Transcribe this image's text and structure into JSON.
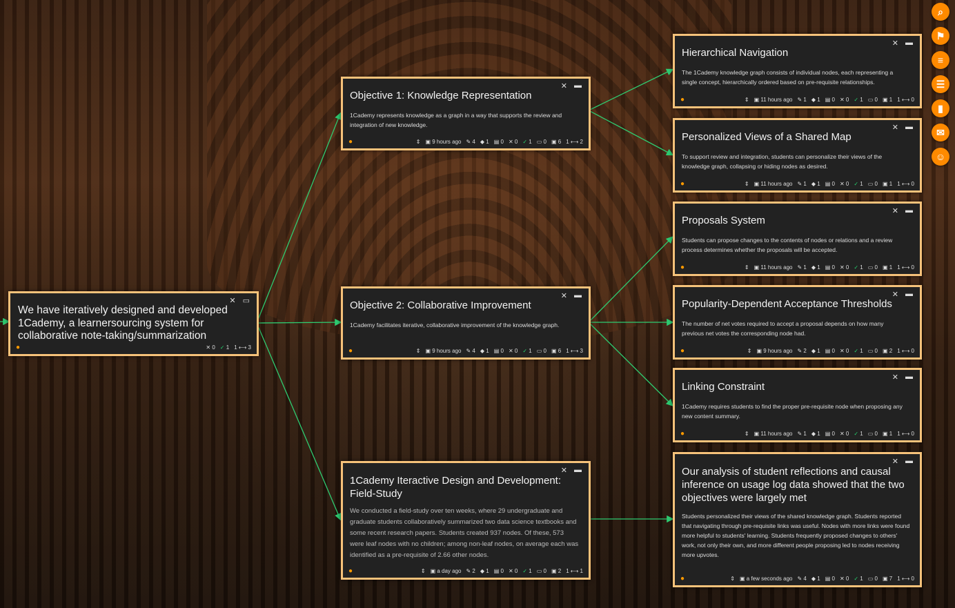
{
  "sidebar": {
    "buttons": [
      {
        "icon": "search-icon",
        "glyph": "⌕"
      },
      {
        "icon": "bookmark-icon",
        "glyph": "⚑"
      },
      {
        "icon": "pending-proposals-icon",
        "glyph": "≡"
      },
      {
        "icon": "list-icon",
        "glyph": "☰"
      },
      {
        "icon": "leaderboard-icon",
        "glyph": "▮"
      },
      {
        "icon": "chat-icon",
        "glyph": "✉"
      },
      {
        "icon": "users-icon",
        "glyph": "☺"
      }
    ]
  },
  "nodes": [
    {
      "id": "root",
      "title": "We have iteratively designed and developed 1Cademy, a learnersourcing system for collaborative note-taking/summarization",
      "content": "",
      "footer": {
        "time": "",
        "edits": "",
        "tags": "",
        "comments": "",
        "wrong": "0",
        "correct": "1",
        "bookmarks": "",
        "proposals": "",
        "links": "1 ⟷ 3"
      }
    },
    {
      "id": "obj1",
      "title": "Objective 1: Knowledge Representation",
      "content": "1Cademy represents knowledge as a graph in a way that supports the review and integration of new knowledge.",
      "footer": {
        "time": "9 hours ago",
        "edits": "4",
        "tags": "1",
        "comments": "0",
        "wrong": "0",
        "correct": "1",
        "bookmarks": "0",
        "proposals": "6",
        "links": "1 ⟷ 2"
      }
    },
    {
      "id": "obj2",
      "title": "Objective 2: Collaborative Improvement",
      "content": "1Cademy facilitates iterative, collaborative improvement of the knowledge graph.",
      "footer": {
        "time": "9 hours ago",
        "edits": "4",
        "tags": "1",
        "comments": "0",
        "wrong": "0",
        "correct": "1",
        "bookmarks": "0",
        "proposals": "6",
        "links": "1 ⟷ 3"
      }
    },
    {
      "id": "field",
      "title": "1Cademy Iteractive Design and Development: Field-Study",
      "content": "We conducted a field-study over ten weeks, where 29 undergraduate and graduate students collaboratively summarized two data science textbooks and some recent research papers. Students created 937 nodes. Of these, 573 were leaf nodes with no children; among non-leaf nodes, on average each was identified as a pre-requisite of 2.66 other nodes.",
      "footer": {
        "time": "a day ago",
        "edits": "2",
        "tags": "1",
        "comments": "0",
        "wrong": "0",
        "correct": "1",
        "bookmarks": "0",
        "proposals": "2",
        "links": "1 ⟷ 1"
      }
    },
    {
      "id": "hier",
      "title": "Hierarchical Navigation",
      "content": "The 1Cademy knowledge graph consists of individual nodes, each representing a single concept, hierarchically ordered based on pre-requisite relationships.",
      "footer": {
        "time": "11 hours ago",
        "edits": "1",
        "tags": "1",
        "comments": "0",
        "wrong": "0",
        "correct": "1",
        "bookmarks": "0",
        "proposals": "1",
        "links": "1 ⟷ 0"
      }
    },
    {
      "id": "pers",
      "title": "Personalized Views of a Shared Map",
      "content": "To support review and integration, students can personalize their views of the knowledge graph, collapsing or hiding nodes as desired.",
      "footer": {
        "time": "11 hours ago",
        "edits": "1",
        "tags": "1",
        "comments": "0",
        "wrong": "0",
        "correct": "1",
        "bookmarks": "0",
        "proposals": "1",
        "links": "1 ⟷ 0"
      }
    },
    {
      "id": "prop",
      "title": "Proposals System",
      "content": "Students can propose changes to the contents of nodes or relations and a review process determines whether the proposals will be accepted.",
      "footer": {
        "time": "11 hours ago",
        "edits": "1",
        "tags": "1",
        "comments": "0",
        "wrong": "0",
        "correct": "1",
        "bookmarks": "0",
        "proposals": "1",
        "links": "1 ⟷ 0"
      }
    },
    {
      "id": "pop",
      "title": "Popularity-Dependent Acceptance Thresholds",
      "content": "The number of net votes required to accept a proposal depends on how many previous net votes the corresponding node had.",
      "footer": {
        "time": "9 hours ago",
        "edits": "2",
        "tags": "1",
        "comments": "0",
        "wrong": "0",
        "correct": "1",
        "bookmarks": "0",
        "proposals": "2",
        "links": "1 ⟷ 0"
      }
    },
    {
      "id": "link",
      "title": "Linking Constraint",
      "content": "1Cademy requires students to find the proper pre-requisite node when proposing any new content summary.",
      "footer": {
        "time": "11 hours ago",
        "edits": "1",
        "tags": "1",
        "comments": "0",
        "wrong": "0",
        "correct": "1",
        "bookmarks": "0",
        "proposals": "1",
        "links": "1 ⟷ 0"
      }
    },
    {
      "id": "anal",
      "title": "Our analysis of student reflections and causal inference on usage log data showed that the two objectives were largely met",
      "content": "Students personalized their views of the shared knowledge graph. Students reported that navigating through pre-requisite links was useful. Nodes with more links were found more helpful to students' learning. Students frequently proposed changes to others' work, not only their own, and more different people proposing led to nodes receiving more upvotes.",
      "footer": {
        "time": "a few seconds ago",
        "edits": "4",
        "tags": "1",
        "comments": "0",
        "wrong": "0",
        "correct": "1",
        "bookmarks": "0",
        "proposals": "7",
        "links": "1 ⟷ 0"
      }
    }
  ],
  "edge_color": "#2ecc71",
  "accent": "#ff8a00",
  "border": "#f6c27a"
}
